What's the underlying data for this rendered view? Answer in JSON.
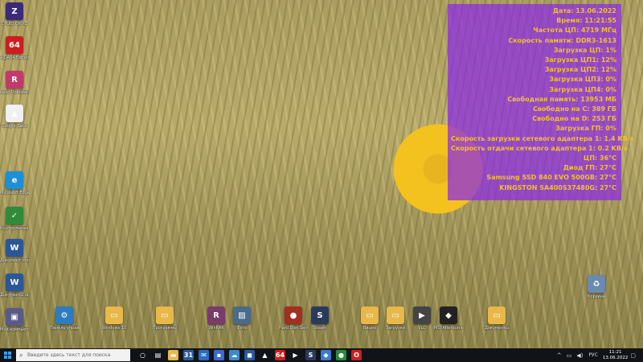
{
  "desktop": {
    "left_icons": [
      {
        "label": "CPUID CPU-Z",
        "name": "cpuz-icon",
        "glyph": "Z",
        "color": "#3b2a7a"
      },
      {
        "label": "AIDA64 Extreme",
        "name": "aida64-icon",
        "glyph": "64",
        "color": "#cc1e1e"
      },
      {
        "label": "Revo Uninstaller",
        "name": "revo-icon",
        "glyph": "R",
        "color": "#c23a6a"
      },
      {
        "label": "Google Диск",
        "name": "google-drive-icon",
        "glyph": "▲",
        "color": "#f0f0f0"
      },
      {
        "label": "Microsoft Edge",
        "name": "edge-icon",
        "glyph": "e",
        "color": "#1d8fd6"
      },
      {
        "label": "Контрольные суммы",
        "name": "checksum-icon",
        "glyph": "✓",
        "color": "#2f8a3a"
      },
      {
        "label": "Документ.docx",
        "name": "word-doc-icon",
        "glyph": "W",
        "color": "#2b5797"
      },
      {
        "label": "Документ2.docx",
        "name": "word-doc2-icon",
        "glyph": "W",
        "color": "#2b5797"
      },
      {
        "label": "Мой компьютер",
        "name": "computer-icon",
        "glyph": "▣",
        "color": "#5a5a8a"
      }
    ],
    "bottom_icons": [
      {
        "label": "Панель управления",
        "name": "control-panel-icon",
        "glyph": "⚙",
        "color": "#2d7cc0"
      },
      {
        "label": "Windows 10",
        "name": "folder-icon-1",
        "glyph": "▭",
        "color": "#e8b84a"
      },
      {
        "label": "Программы",
        "name": "folder-icon-2",
        "glyph": "▭",
        "color": "#e8b84a"
      },
      {
        "label": "WinRAR",
        "name": "winrar-icon",
        "glyph": "R",
        "color": "#7a3a6a"
      },
      {
        "label": "Фото",
        "name": "photos-icon",
        "glyph": "▨",
        "color": "#4a6a8a"
      },
      {
        "label": "Hard Disk Sentinel",
        "name": "hdsentinel-icon",
        "glyph": "●",
        "color": "#a03020"
      },
      {
        "label": "Steam",
        "name": "steam-icon",
        "glyph": "S",
        "color": "#2a3a5a"
      },
      {
        "label": "Видео",
        "name": "folder-icon-3",
        "glyph": "▭",
        "color": "#e8b84a"
      },
      {
        "label": "Загрузки",
        "name": "folder-icon-4",
        "glyph": "▭",
        "color": "#e8b84a"
      },
      {
        "label": "VLC",
        "name": "vlc-icon",
        "glyph": "▶",
        "color": "#444"
      },
      {
        "label": "MSI Afterburner",
        "name": "afterburner-icon",
        "glyph": "◆",
        "color": "#222"
      },
      {
        "label": "Документы",
        "name": "folder-icon-5",
        "glyph": "▭",
        "color": "#e8b84a"
      },
      {
        "label": "Корзина",
        "name": "recycle-bin-icon",
        "glyph": "♻",
        "color": "#6a8ab0"
      }
    ]
  },
  "sensor_panel": {
    "lines": [
      "Дата: 13.06.2022",
      "Время: 11:21:55",
      "Частота ЦП: 4719 МГц",
      "Скорость памяти: DDR3-1613",
      "Загрузка ЦП: 1%",
      "Загрузка ЦП1: 12%",
      "Загрузка ЦП2: 12%",
      "Загрузка ЦП3: 0%",
      "Загрузка ЦП4: 0%",
      "Свободная память: 13953 МБ",
      "Свободно на C: 389 ГБ",
      "Свободно на D: 253 ГБ",
      "Загрузка ГП: 0%",
      "Скорость загрузки сетевого адаптера 1: 1.4 KB/s",
      "Скорость отдачи сетевого адаптера 1: 0.2 KB/s",
      "ЦП: 36°C",
      "Диод ГП: 27°C",
      "Samsung SSD 840 EVO 500GB: 27°C",
      "KINGSTON SA400S37480G: 27°C"
    ],
    "text_color": "#f1c030",
    "bg_color": "#8a28e6"
  },
  "taskbar": {
    "search_placeholder": "Введите здесь текст для поиска",
    "pinned": [
      {
        "name": "task-view-icon",
        "glyph": "○",
        "color": "#101418"
      },
      {
        "name": "task-switch-icon",
        "glyph": "▤",
        "color": "#101418"
      },
      {
        "name": "explorer-icon",
        "glyph": "▬",
        "color": "#e8b84a"
      },
      {
        "name": "calendar-icon",
        "glyph": "31",
        "color": "#2a5aa0"
      },
      {
        "name": "mail-icon",
        "glyph": "✉",
        "color": "#2a6ac0"
      },
      {
        "name": "save-icon",
        "glyph": "▪",
        "color": "#3a6ad0"
      },
      {
        "name": "onedrive-icon",
        "glyph": "☁",
        "color": "#3a8ad0"
      },
      {
        "name": "store-icon",
        "glyph": "◼",
        "color": "#2a5aa0"
      },
      {
        "name": "drive-icon",
        "glyph": "▲",
        "color": "#101418"
      },
      {
        "name": "aida-task-icon",
        "glyph": "64",
        "color": "#cc1e1e"
      },
      {
        "name": "play-store-icon",
        "glyph": "▶",
        "color": "#101418"
      },
      {
        "name": "steam-task-icon",
        "glyph": "S",
        "color": "#2a3a5a"
      },
      {
        "name": "blue-icon",
        "glyph": "◆",
        "color": "#3a7ad0"
      },
      {
        "name": "green-icon",
        "glyph": "●",
        "color": "#2a8a3a"
      },
      {
        "name": "opera-icon",
        "glyph": "O",
        "color": "#cc1e1e"
      }
    ],
    "tray": {
      "chevron": "^",
      "network": "▭",
      "volume": "◀)",
      "language": "РУС",
      "time": "11:21",
      "date": "13.06.2022",
      "notifications": "▢"
    }
  }
}
